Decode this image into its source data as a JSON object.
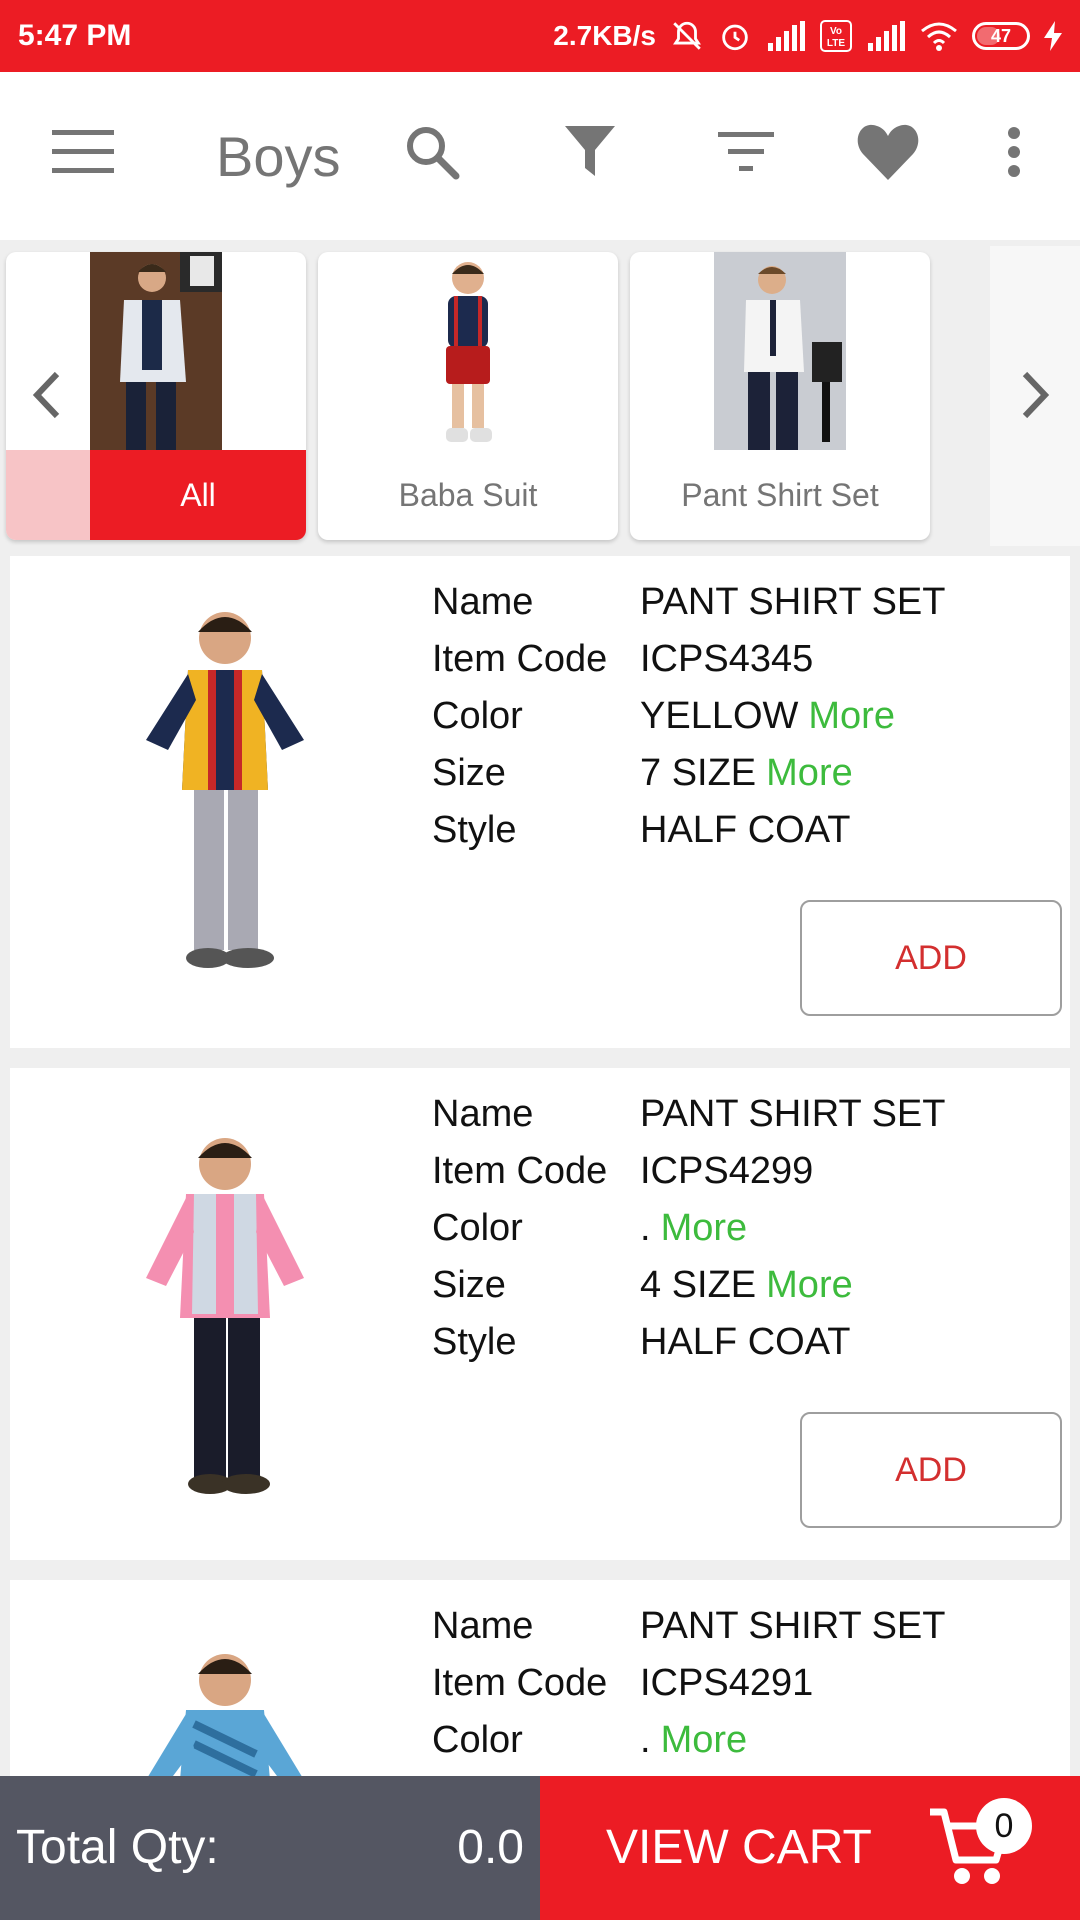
{
  "status_bar": {
    "time": "5:47 PM",
    "net_speed": "2.7KB/s",
    "volte": "Vo LTE",
    "battery": "47"
  },
  "toolbar": {
    "title": "Boys"
  },
  "categories": [
    {
      "label": "All"
    },
    {
      "label": "Baba Suit"
    },
    {
      "label": "Pant Shirt Set"
    }
  ],
  "spec_labels": {
    "name": "Name",
    "item_code": "Item Code",
    "color": "Color",
    "size": "Size",
    "style": "Style"
  },
  "products": [
    {
      "name": "PANT SHIRT SET",
      "item_code": "ICPS4345",
      "color": "YELLOW",
      "color_more": "More",
      "size": "7 SIZE",
      "size_more": "More",
      "style": "HALF COAT",
      "add_label": "ADD"
    },
    {
      "name": "PANT SHIRT SET",
      "item_code": "ICPS4299",
      "color": ".",
      "color_more": "More",
      "size": "4 SIZE",
      "size_more": "More",
      "style": "HALF COAT",
      "add_label": "ADD"
    },
    {
      "name": "PANT SHIRT SET",
      "item_code": "ICPS4291",
      "color": ".",
      "color_more": "More"
    }
  ],
  "bottom_bar": {
    "total_qty_label": "Total Qty:",
    "total_qty_value": "0.0",
    "view_cart_label": "VIEW CART",
    "cart_count": "0"
  },
  "colors": {
    "brand_red": "#ec1c24",
    "more_green": "#3dbb3d",
    "bottom_gray": "#545662"
  }
}
